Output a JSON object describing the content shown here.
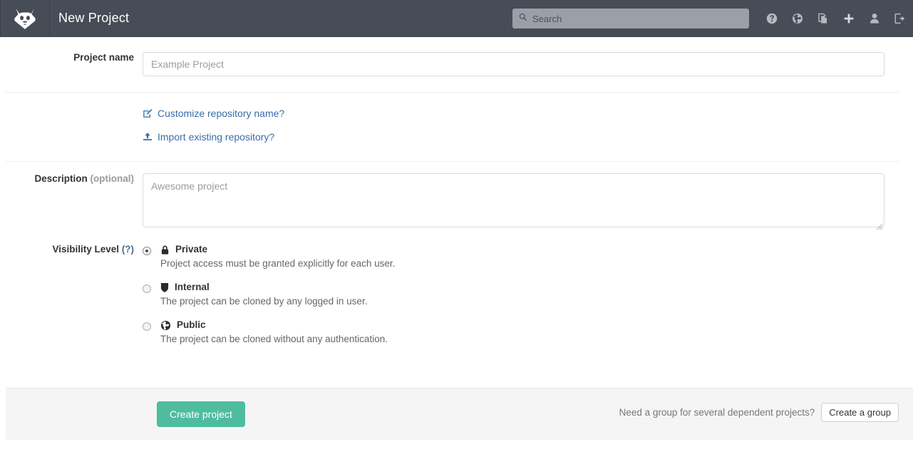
{
  "navbar": {
    "logo_icon": "gitlab-tanuki-logo",
    "title": "New Project",
    "search": {
      "placeholder": "Search",
      "value": "",
      "icon": "search-icon"
    },
    "icons": [
      {
        "name": "help-icon",
        "label": "Help"
      },
      {
        "name": "globe-icon",
        "label": "Public Area"
      },
      {
        "name": "copy-files-icon",
        "label": "Snippets"
      },
      {
        "name": "plus-icon",
        "label": "New"
      },
      {
        "name": "user-icon",
        "label": "Profile"
      },
      {
        "name": "sign-out-icon",
        "label": "Sign out"
      }
    ]
  },
  "form": {
    "project_name": {
      "label": "Project name",
      "placeholder": "Example Project",
      "value": ""
    },
    "links": [
      {
        "name": "customize-repository-name-link",
        "icon": "pencil-square-icon",
        "label": "Customize repository name?"
      },
      {
        "name": "import-existing-repository-link",
        "icon": "upload-icon",
        "label": "Import existing repository?"
      }
    ],
    "description": {
      "label": "Description",
      "label_suffix": "(optional)",
      "placeholder": "Awesome project",
      "value": ""
    },
    "visibility": {
      "label": "Visibility Level",
      "help_marker": "(?)",
      "options": [
        {
          "id": "private",
          "icon": "lock-icon",
          "title": "Private",
          "description": "Project access must be granted explicitly for each user.",
          "selected": true
        },
        {
          "id": "internal",
          "icon": "shield-icon",
          "title": "Internal",
          "description": "The project can be cloned by any logged in user.",
          "selected": false
        },
        {
          "id": "public",
          "icon": "globe-icon",
          "title": "Public",
          "description": "The project can be cloned without any authentication.",
          "selected": false
        }
      ]
    }
  },
  "footer": {
    "create_project_label": "Create project",
    "group_note": "Need a group for several dependent projects?",
    "create_group_label": "Create a group"
  },
  "colors": {
    "navbar_bg": "#474d57",
    "primary_button": "#4fbca0",
    "link": "#3a6da8",
    "footer_bg": "#f5f5f5"
  }
}
